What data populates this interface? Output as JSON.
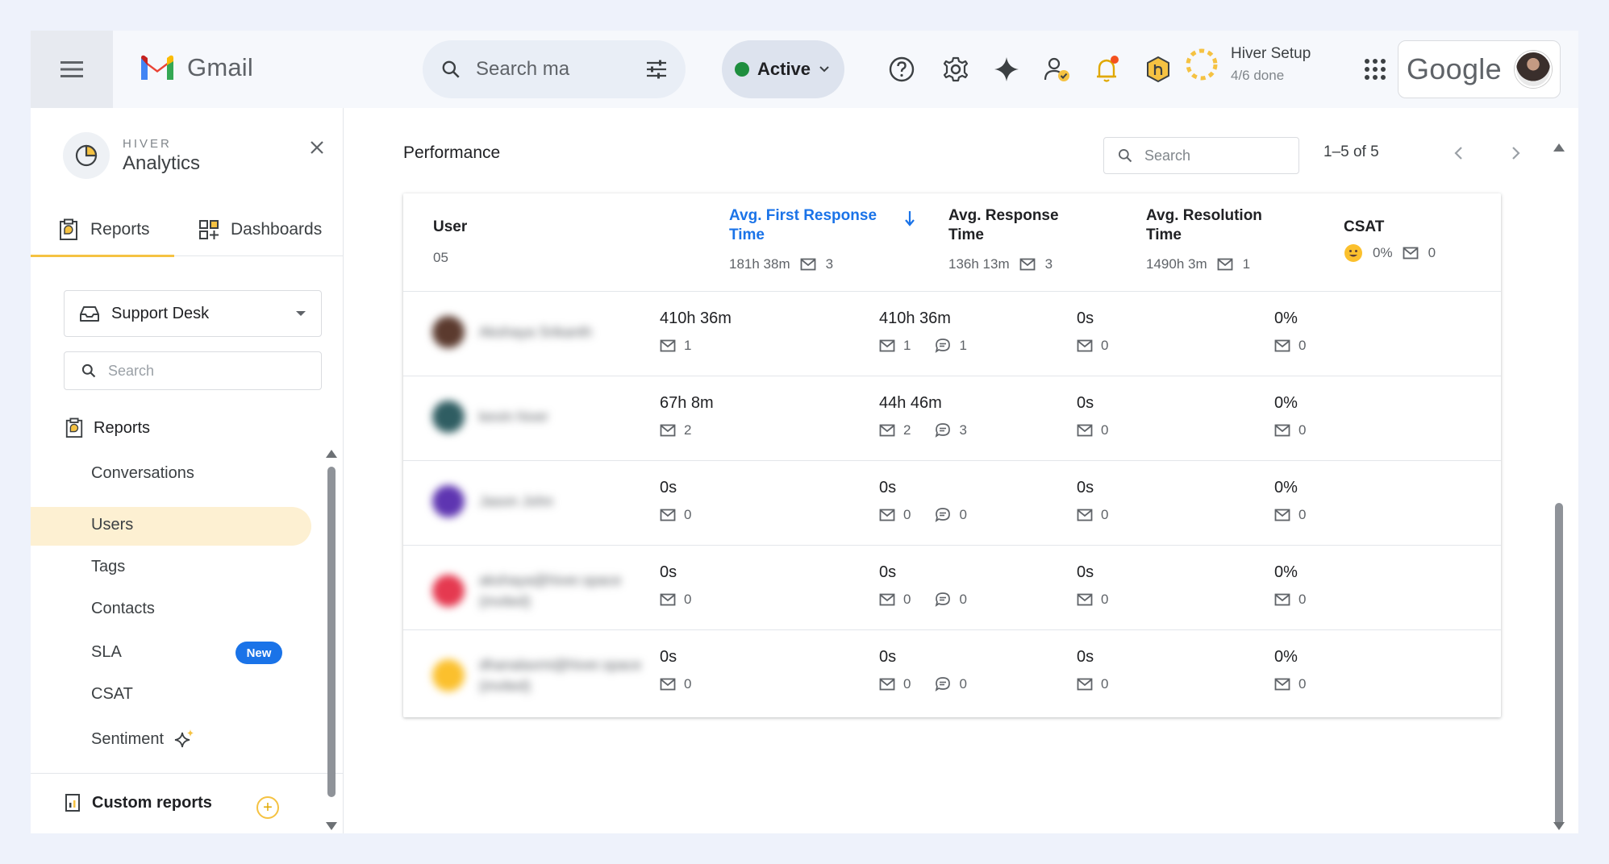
{
  "app": {
    "name": "Gmail",
    "search_placeholder": "Search ma",
    "status_label": "Active",
    "setup_title": "Hiver Setup",
    "setup_progress": "4/6 done",
    "brand": "Google"
  },
  "sidebar": {
    "brand_small": "HIVER",
    "brand_title": "Analytics",
    "tabs": [
      {
        "label": "Reports",
        "active": true
      },
      {
        "label": "Dashboards",
        "active": false
      }
    ],
    "inbox_select": "Support Desk",
    "search_placeholder": "Search",
    "section_title": "Reports",
    "items": [
      {
        "label": "Conversations"
      },
      {
        "label": "Users",
        "active": true
      },
      {
        "label": "Tags"
      },
      {
        "label": "Contacts"
      },
      {
        "label": "SLA",
        "badge": "New"
      },
      {
        "label": "CSAT"
      },
      {
        "label": "Sentiment"
      }
    ],
    "custom_reports": "Custom reports"
  },
  "main": {
    "title": "Performance",
    "search_placeholder": "Search",
    "pagination": "1–5 of 5",
    "columns": [
      {
        "name": "User",
        "sub": "05"
      },
      {
        "name_l1": "Avg. First Response",
        "name_l2": "Time",
        "sub_value": "181h 38m",
        "sub_count": "3",
        "sorted": true
      },
      {
        "name_l1": "Avg. Response",
        "name_l2": "Time",
        "sub_value": "136h 13m",
        "sub_count": "3"
      },
      {
        "name_l1": "Avg. Resolution",
        "name_l2": "Time",
        "sub_value": "1490h 3m",
        "sub_count": "1"
      },
      {
        "name": "CSAT",
        "sub_value": "0%",
        "sub_count": "0"
      }
    ],
    "rows": [
      {
        "user": "Akshaya Srikanth",
        "user_sub": "",
        "avatar_color": "#5b3a2e",
        "frt": "410h 36m",
        "frt_mail": "1",
        "rt": "410h 36m",
        "rt_mail": "1",
        "rt_chat": "1",
        "res": "0s",
        "res_mail": "0",
        "csat": "0%",
        "csat_mail": "0"
      },
      {
        "user": "kevin hiver",
        "user_sub": "",
        "avatar_color": "#2f5d62",
        "frt": "67h 8m",
        "frt_mail": "2",
        "rt": "44h 46m",
        "rt_mail": "2",
        "rt_chat": "3",
        "res": "0s",
        "res_mail": "0",
        "csat": "0%",
        "csat_mail": "0"
      },
      {
        "user": "Jason John",
        "user_sub": "",
        "avatar_color": "#5e35b1",
        "frt": "0s",
        "frt_mail": "0",
        "rt": "0s",
        "rt_mail": "0",
        "rt_chat": "0",
        "res": "0s",
        "res_mail": "0",
        "csat": "0%",
        "csat_mail": "0"
      },
      {
        "user": "akshaya@hiver.space",
        "user_sub": "(invited)",
        "avatar_color": "#e53950",
        "frt": "0s",
        "frt_mail": "0",
        "rt": "0s",
        "rt_mail": "0",
        "rt_chat": "0",
        "res": "0s",
        "res_mail": "0",
        "csat": "0%",
        "csat_mail": "0"
      },
      {
        "user": "dhanalaxmi@hiver.space",
        "user_sub": "(invited)",
        "avatar_color": "#fbc02d",
        "frt": "0s",
        "frt_mail": "0",
        "rt": "0s",
        "rt_mail": "0",
        "rt_chat": "0",
        "res": "0s",
        "res_mail": "0",
        "csat": "0%",
        "csat_mail": "0"
      }
    ]
  },
  "colors": {
    "accent_blue": "#1a73e8",
    "accent_yellow": "#f5c242",
    "active_green": "#1e8e3e"
  }
}
